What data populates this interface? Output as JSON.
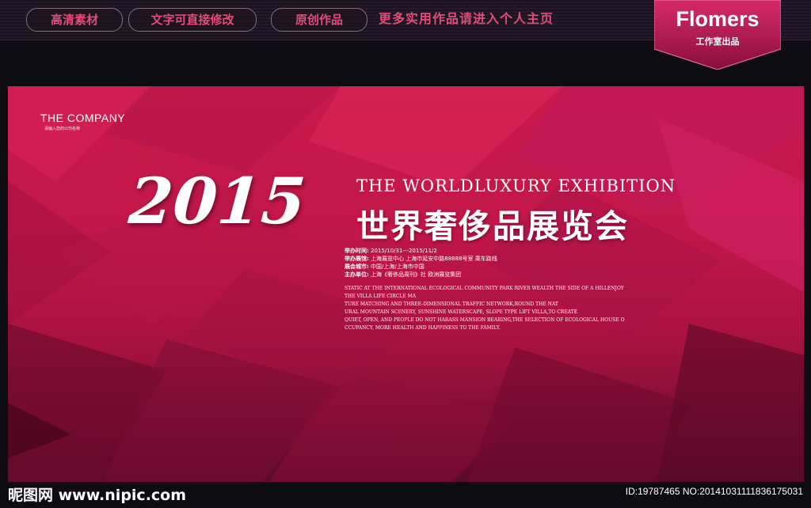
{
  "header": {
    "pills": [
      "高清素材",
      "文字可直接修改",
      "原创作品"
    ],
    "link": "更多实用作品请进入个人主页",
    "brand_name": "Flomers",
    "brand_sub": "工作室出品"
  },
  "poster": {
    "company_name": "THE COMPANY",
    "company_sub": "请输入您的公司名称",
    "year": "2015",
    "title_en": "THE WORLDLUXURY EXHIBITION",
    "title_cn": "世界奢侈品展览会",
    "info": [
      {
        "label": "举办时间:",
        "value": "2015/10/31---2015/11/2"
      },
      {
        "label": "举办展馆:",
        "value": "上海展览中心 上海市延安中路88888号室  乘车路线"
      },
      {
        "label": "展会城市:",
        "value": "中国/上海/上海市中国"
      },
      {
        "label": "主办单位:",
        "value": "上海《奢侈品周刊》社 欧洲展览集团"
      }
    ],
    "paragraph": [
      "STATIC AT THE INTERNATIONAL ECOLOGICAL COMMUNITY PARK RIVER WEALTH THE SIDE OF A HILLENJOY",
      "THE VILLA LIFE CIRCLE MA",
      "TURE MATCHING AND THREE-DIMENSIONAL TRAFFIC NETWORK,ROUND THE NAT",
      "URAL MOUNTAIN SCENERY, SUNSHINE WATERSCAPE, SLOPE TYPE LIFT VILLA,TO CREATE",
      "QUIET, OPEN, AND PEOPLE DO NOT HARASS MANSION BEARING,THE SELECTION OF ECOLOGICAL HOUSE O",
      "CCUPANCY, MORE HEALTH AND HAPPINESS TO THE FAMILY."
    ]
  },
  "watermark": {
    "left": "昵图网 www.nipic.com",
    "right": "ID:19787465 NO:20141031111836175031"
  },
  "colors": {
    "accent_pink": "#e64a7a",
    "poster_red": "#c81a4a",
    "badge": "#c0185a"
  }
}
